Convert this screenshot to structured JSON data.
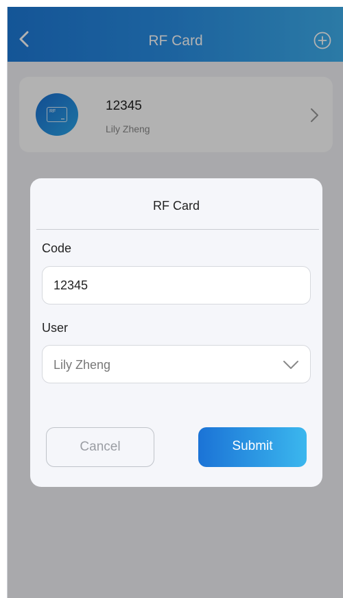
{
  "header": {
    "title": "RF Card"
  },
  "card": {
    "icon_label": "RF",
    "code": "12345",
    "user": "Lily Zheng"
  },
  "dialog": {
    "title": "RF Card",
    "code_label": "Code",
    "code_value": "12345",
    "user_label": "User",
    "user_value": "Lily Zheng",
    "cancel_label": "Cancel",
    "submit_label": "Submit"
  },
  "icons": [
    "back-icon",
    "add-icon",
    "rf-card-icon",
    "chevron-right-icon",
    "chevron-down-icon"
  ],
  "colors": {
    "accent": "#1e7ad8",
    "accent_light": "#3bb7ee",
    "overlay": "#000000"
  }
}
